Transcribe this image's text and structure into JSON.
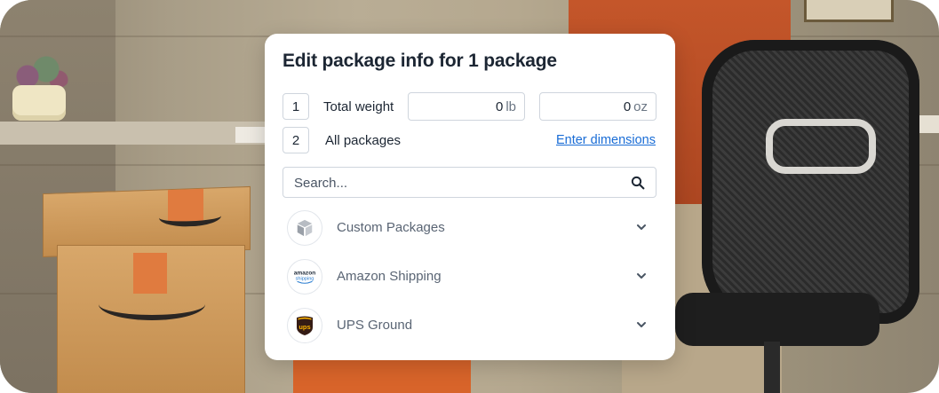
{
  "modal": {
    "title": "Edit package info for 1 package",
    "rows": [
      {
        "number": "1",
        "label": "Total weight"
      },
      {
        "number": "2",
        "label": "All packages"
      }
    ],
    "weight": {
      "lb_value": "0",
      "lb_unit": "lb",
      "oz_value": "0",
      "oz_unit": "oz"
    },
    "dimensions_link": "Enter dimensions",
    "search": {
      "placeholder": "Search..."
    },
    "carriers": [
      {
        "name": "Custom Packages",
        "icon": "package-icon"
      },
      {
        "name": "Amazon Shipping",
        "icon": "amazon-shipping-logo",
        "logo_text_1": "amazon",
        "logo_text_2": "shipping"
      },
      {
        "name": "UPS Ground",
        "icon": "ups-logo",
        "logo_text": "ups"
      }
    ]
  },
  "colors": {
    "title": "#1c2633",
    "link": "#1a6dd6",
    "border": "#cfd5dd",
    "ups_brown": "#351c15",
    "ups_gold": "#ffb500"
  }
}
